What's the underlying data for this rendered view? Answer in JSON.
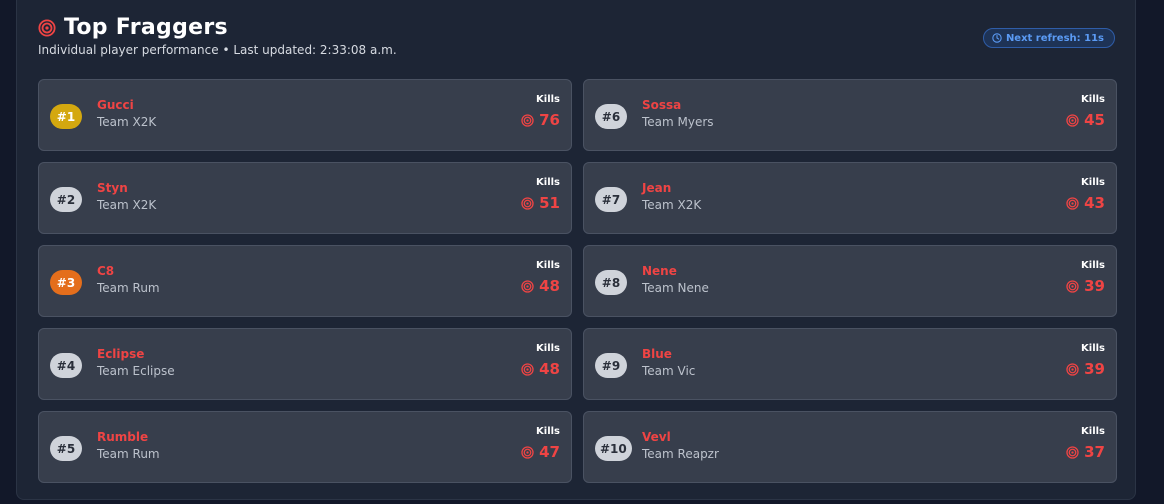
{
  "header": {
    "title": "Top Fraggers",
    "subtitle": "Individual player performance • Last updated: 2:33:08 a.m.",
    "title_icon": "target-icon"
  },
  "refresh": {
    "label": "Next refresh: 11s",
    "icon": "clock-icon"
  },
  "colors": {
    "accent_red": "#ef4444",
    "gold": "#d4a80f",
    "bronze": "#e46e1c",
    "default_rank": "#cfd3da",
    "refresh_blue": "#5b9bf5"
  },
  "kills_label": "Kills",
  "players": [
    {
      "rank": "#1",
      "name": "Gucci",
      "team": "Team X2K",
      "kills": "76",
      "tier": "gold"
    },
    {
      "rank": "#2",
      "name": "Styn",
      "team": "Team X2K",
      "kills": "51",
      "tier": "default"
    },
    {
      "rank": "#3",
      "name": "C8",
      "team": "Team Rum",
      "kills": "48",
      "tier": "bronze"
    },
    {
      "rank": "#4",
      "name": "Eclipse",
      "team": "Team Eclipse",
      "kills": "48",
      "tier": "default"
    },
    {
      "rank": "#5",
      "name": "Rumble",
      "team": "Team Rum",
      "kills": "47",
      "tier": "default"
    },
    {
      "rank": "#6",
      "name": "Sossa",
      "team": "Team Myers",
      "kills": "45",
      "tier": "default"
    },
    {
      "rank": "#7",
      "name": "Jean",
      "team": "Team X2K",
      "kills": "43",
      "tier": "default"
    },
    {
      "rank": "#8",
      "name": "Nene",
      "team": "Team Nene",
      "kills": "39",
      "tier": "default"
    },
    {
      "rank": "#9",
      "name": "Blue",
      "team": "Team Vic",
      "kills": "39",
      "tier": "default"
    },
    {
      "rank": "#10",
      "name": "Vevl",
      "team": "Team Reapzr",
      "kills": "37",
      "tier": "default"
    }
  ]
}
